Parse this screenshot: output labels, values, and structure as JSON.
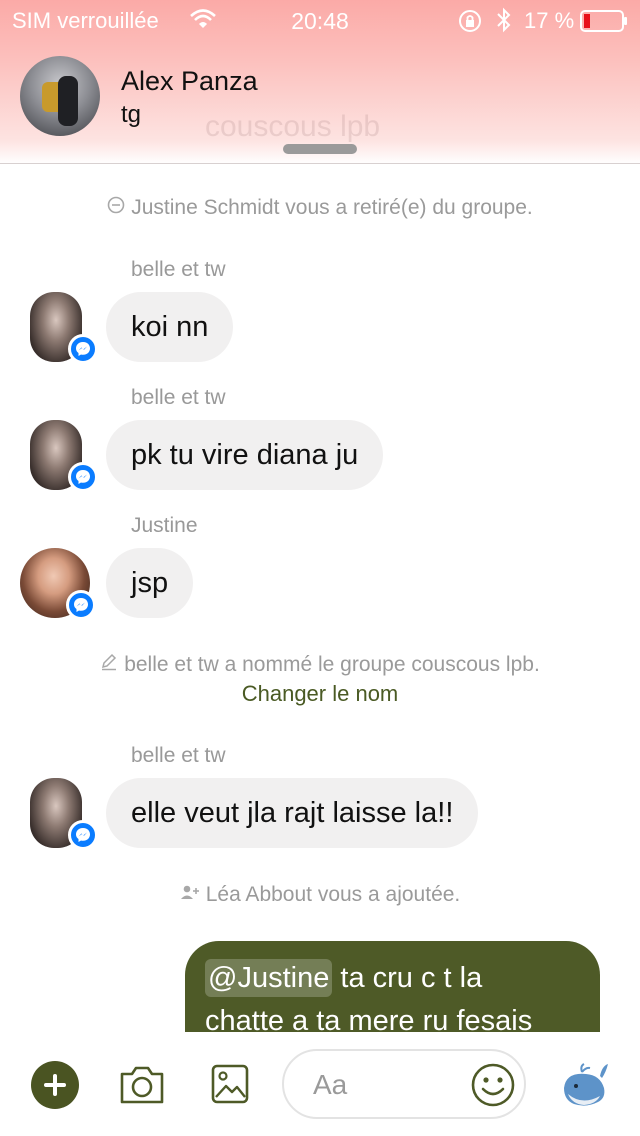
{
  "status_bar": {
    "carrier": "SIM verrouillée",
    "time": "20:48",
    "battery_percent": "17 %",
    "battery_level": 0.17
  },
  "header": {
    "name": "Alex Panza",
    "subtitle": "tg",
    "background_preview_text": "couscous lpb"
  },
  "conversation": {
    "system_messages": {
      "removed": "Justine Schmidt vous a retiré(e) du groupe.",
      "renamed": "belle et tw a nommé le groupe couscous lpb.",
      "rename_action": "Changer le nom",
      "added": "Léa Abbout vous a ajoutée."
    },
    "messages": [
      {
        "sender": "belle et tw",
        "text": "koi nn"
      },
      {
        "sender": "belle et tw",
        "text": "pk tu vire diana ju"
      },
      {
        "sender": "Justine",
        "text": "jsp"
      },
      {
        "sender": "belle et tw",
        "text": "elle veut jla rajt laisse la!!"
      }
    ],
    "outgoing": {
      "mention": "@Justine",
      "text_line1": " ta cru c t la",
      "text_line2": "chatte a ta mere ru fesais"
    }
  },
  "composer": {
    "placeholder": "Aa"
  },
  "colors": {
    "theme": "#4e5a27",
    "messenger_badge": "#0a7cff",
    "bubble_incoming": "#f1f0f0"
  },
  "icons": [
    "wifi-icon",
    "lock-rotation-icon",
    "bluetooth-icon",
    "battery-icon",
    "messenger-badge-icon",
    "minus-circle-icon",
    "pencil-icon",
    "add-person-icon",
    "plus-icon",
    "camera-icon",
    "gallery-icon",
    "emoji-icon",
    "whale-sticker-icon"
  ]
}
